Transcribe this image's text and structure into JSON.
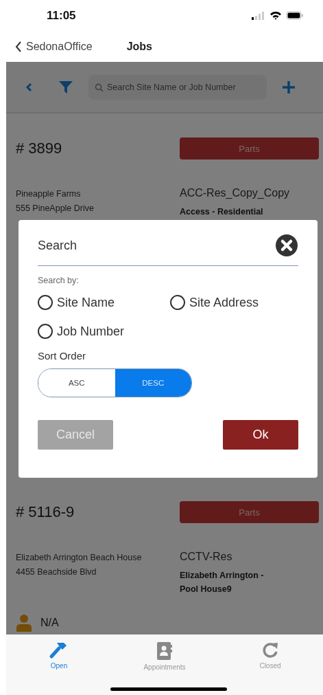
{
  "status_bar": {
    "time": "11:05"
  },
  "nav": {
    "back_label": "SedonaOffice",
    "title": "Jobs"
  },
  "toolbar": {
    "search": {
      "placeholder": "Search Site Name or Job Number"
    }
  },
  "jobs": [
    {
      "number": "# 3899",
      "status": "Parts",
      "site_name": "Pineapple Farms",
      "site_address": "555 PineApple Drive",
      "job_type": "ACC-Res_Copy_Copy",
      "description": "Access - Residential"
    },
    {
      "number": "# 5116-9",
      "status": "Parts",
      "site_name": "Elizabeth Arrington Beach House",
      "site_address": "4455 Beachside Blvd",
      "job_type": "CCTV-Res",
      "description": "Elizabeth Arrington - Pool House9",
      "technician": "N/A"
    }
  ],
  "modal": {
    "title": "Search",
    "search_by_label": "Search by:",
    "search_by": [
      {
        "label": "Site Name",
        "selected": false
      },
      {
        "label": "Site Address",
        "selected": false
      },
      {
        "label": "Job Number",
        "selected": false
      }
    ],
    "sort_label": "Sort Order",
    "sort_options": [
      {
        "label": "ASC",
        "selected": false
      },
      {
        "label": "DESC",
        "selected": true
      }
    ],
    "buttons": [
      {
        "label": "Cancel",
        "kind": "cancel"
      },
      {
        "label": "Ok",
        "kind": "ok"
      }
    ]
  },
  "tabs": [
    {
      "label": "Open",
      "kind": "hammer",
      "selected": true
    },
    {
      "label": "Appointments",
      "kind": "contacts",
      "selected": false
    },
    {
      "label": "Closed",
      "kind": "refresh",
      "selected": false
    }
  ]
}
